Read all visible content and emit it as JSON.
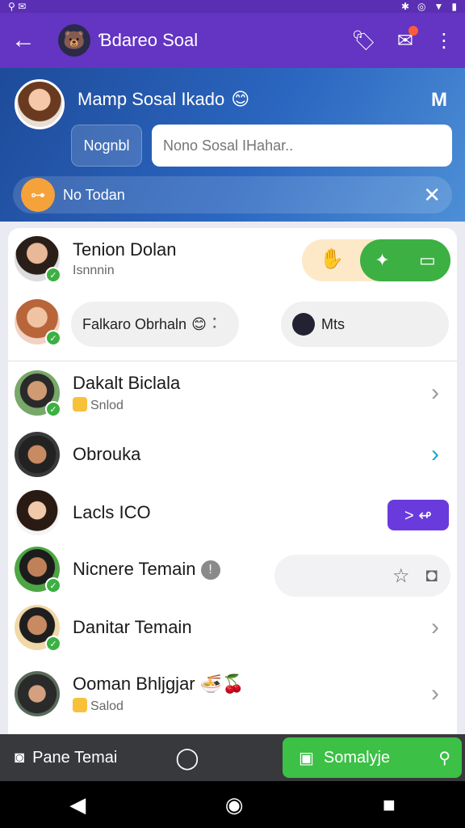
{
  "app": {
    "title": "Ɓdareo Soal"
  },
  "profile": {
    "name": "Mamp Sosal Ikado",
    "emoji": "😊"
  },
  "hero": {
    "button_label": "Nognbl",
    "search_placeholder": "Nono Sosal IHahar..",
    "notice_text": "No Todan"
  },
  "contacts": [
    {
      "name": "Tenion Dolan",
      "sub": "Isnnnin",
      "online": true
    },
    {
      "chip_left": "Falkaro Obrhaln",
      "chip_left_emoji": "😊",
      "chip_right": "Mts",
      "online": true
    },
    {
      "name": "Dakalt Biclala",
      "sub": "Snlod",
      "online": true
    },
    {
      "name": "Obrouka"
    },
    {
      "name": "Lacls ICO"
    },
    {
      "name": "Nicnere Temain",
      "online": true
    },
    {
      "name": "Danitar Temain",
      "online": true
    },
    {
      "name": "Ooman Bhljgjar",
      "sub": "Salod",
      "emoji": "🍜🍒"
    }
  ],
  "bottom": {
    "left_label": "Pane  Temai",
    "primary_label": "Somalyje"
  },
  "colors": {
    "app_bar": "#6434c2",
    "accent_green": "#3cb043",
    "hero_blue": "#2b66c0"
  }
}
